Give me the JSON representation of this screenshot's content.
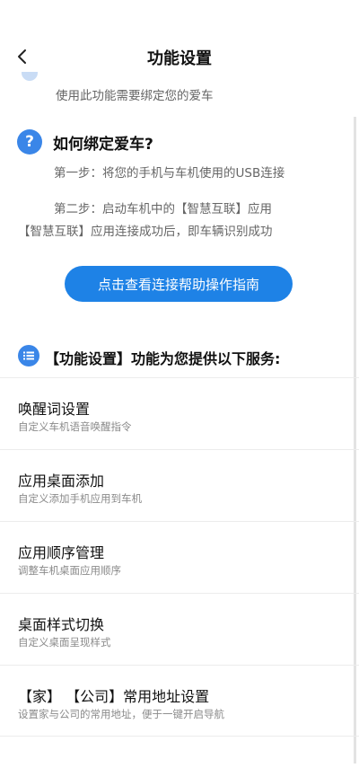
{
  "header": {
    "title": "功能设置"
  },
  "note": "使用此功能需要绑定您的爱车",
  "bind": {
    "icon": "question-icon",
    "icon_glyph": "?",
    "heading": "如何绑定爱车?",
    "step1": "第一步：将您的手机与车机使用的USB连接",
    "step2_line1": "第二步：启动车机中的【智慧互联】应用",
    "step2_line2": "【智慧互联】应用连接成功后，即车辆识别成功",
    "guide_button": "点击查看连接帮助操作指南"
  },
  "services": {
    "icon": "list-icon",
    "heading": "【功能设置】功能为您提供以下服务:",
    "items": [
      {
        "title": "唤醒词设置",
        "desc": "自定义车机语音唤醒指令"
      },
      {
        "title": "应用桌面添加",
        "desc": "自定义添加手机应用到车机"
      },
      {
        "title": "应用顺序管理",
        "desc": "调整车机桌面应用顺序"
      },
      {
        "title": "桌面样式切换",
        "desc": "自定义桌面呈现样式"
      },
      {
        "title": "【家】 【公司】常用地址设置",
        "desc": "设置家与公司的常用地址，便于一键开启导航"
      }
    ]
  },
  "colors": {
    "accent": "#1e82e6",
    "icon_blue": "#3a86e8",
    "secondary_text": "#666666"
  }
}
